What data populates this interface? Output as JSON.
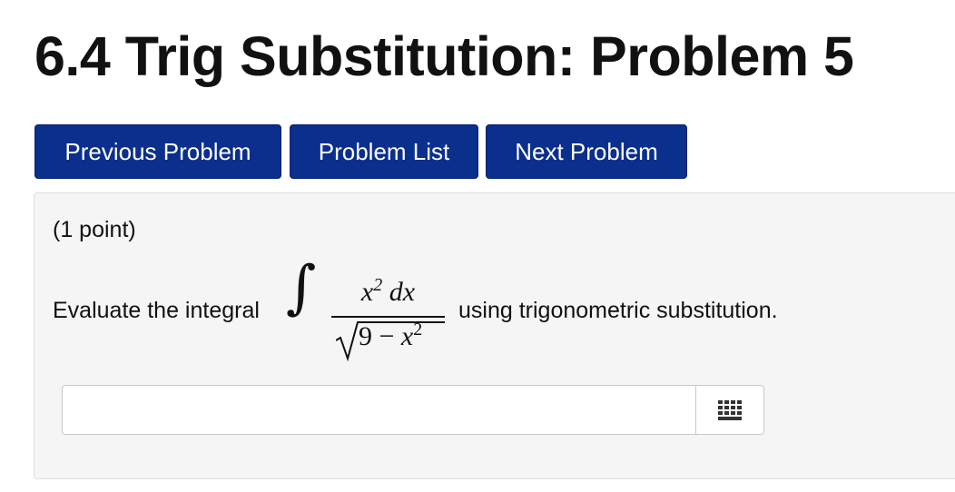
{
  "page": {
    "title": "6.4 Trig Substitution: Problem 5"
  },
  "nav": {
    "previous_label": "Previous Problem",
    "list_label": "Problem List",
    "next_label": "Next Problem"
  },
  "problem": {
    "points": "(1 point)",
    "prompt_before": "Evaluate the integral",
    "prompt_after": "using trigonometric substitution.",
    "integral": {
      "sign": "∫",
      "numerator": "x² dx",
      "denominator": "9 − x²"
    }
  },
  "answer": {
    "value": "",
    "placeholder": "",
    "palette_icon": "equation-grid-icon"
  },
  "colors": {
    "button_bg": "#0a2f8c",
    "button_text": "#ffffff",
    "panel_bg": "#f5f5f5"
  }
}
